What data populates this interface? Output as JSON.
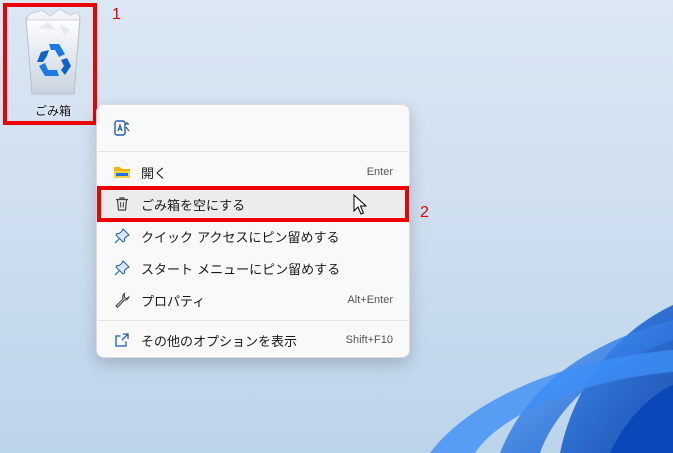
{
  "desktop": {
    "recycle_bin": {
      "label": "ごみ箱",
      "icon": "recycle-bin-icon"
    }
  },
  "annotations": {
    "one": "1",
    "two": "2",
    "highlight_color": "#ee0000"
  },
  "context_menu": {
    "top_action_icon": "ai-translate-icon",
    "items": [
      {
        "label": "開く",
        "shortcut": "Enter",
        "icon": "folder-icon"
      },
      {
        "label": "ごみ箱を空にする",
        "shortcut": "",
        "icon": "trash-icon"
      },
      {
        "label": "クイック アクセスにピン留めする",
        "shortcut": "",
        "icon": "pin-icon"
      },
      {
        "label": "スタート メニューにピン留めする",
        "shortcut": "",
        "icon": "pin-icon"
      },
      {
        "label": "プロパティ",
        "shortcut": "Alt+Enter",
        "icon": "wrench-icon"
      },
      {
        "label": "その他のオプションを表示",
        "shortcut": "Shift+F10",
        "icon": "share-icon"
      }
    ]
  },
  "colors": {
    "accent": "#0067c0",
    "wallpaper_bloom": "#1e6fd9"
  }
}
